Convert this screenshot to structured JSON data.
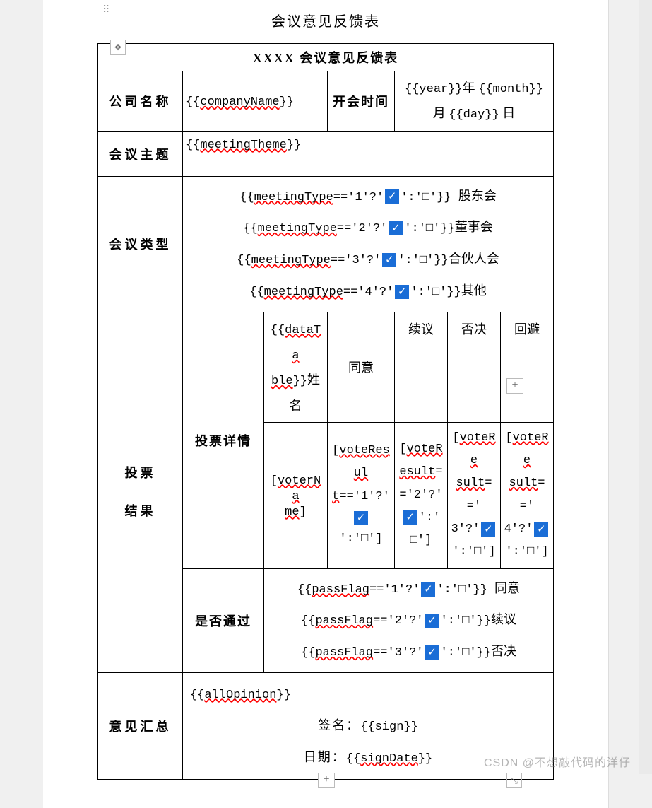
{
  "doc_title": "会议意见反馈表",
  "table": {
    "header": "XXXX 会议意见反馈表",
    "company_label": "公司名称",
    "company_value": "{{companyName}}",
    "time_label": "开会时间",
    "time_value_parts": {
      "year": "{{year}}",
      "year_suffix": "年",
      "month": "{{month}}",
      "month_suffix": "月",
      "day": "{{day}}",
      "day_suffix": "日"
    },
    "theme_label": "会议主题",
    "theme_value": "{{meetingTheme}}",
    "type_label": "会议类型",
    "type_lines": [
      {
        "prefix": "{{meetingType=='1'?'",
        "suffix": "':'□'}} 股东会"
      },
      {
        "prefix": "{{meetingType=='2'?'",
        "suffix": "':'□'}}董事会"
      },
      {
        "prefix": "{{meetingType=='3'?'",
        "suffix": "':'□'}}合伙人会"
      },
      {
        "prefix": "{{meetingType=='4'?'",
        "suffix": "':'□'}}其他"
      }
    ],
    "vote": {
      "left_label_1": "投票",
      "left_label_2": "结果",
      "detail_label": "投票详情",
      "name_col": "{{dataTable}}姓名",
      "cols": [
        "同意",
        "续议",
        "否决",
        "回避"
      ],
      "voter_name": "[voterName]",
      "results": [
        "[voteResult=='1'?'",
        "[voteResult=='2'?'",
        "[voteResult=='3'?'",
        "[voteResult=='4'?'"
      ],
      "result_suffix": "':'□']"
    },
    "pass_label": "是否通过",
    "pass_lines": [
      {
        "prefix": "{{passFlag=='1'?'",
        "suffix": "':'□'}} 同意"
      },
      {
        "prefix": "{{passFlag=='2'?'",
        "suffix": "':'□'}}续议"
      },
      {
        "prefix": "{{passFlag=='3'?'",
        "suffix": "':'□'}}否决"
      }
    ],
    "opinion_label": "意见汇总",
    "opinion_value": "{{allOpinion}}",
    "sign_label": "签名：",
    "sign_value": "{{sign}}",
    "date_label": "日期：",
    "date_value": "{{signDate}}"
  },
  "watermark": "CSDN @不想敲代码的洋仔"
}
